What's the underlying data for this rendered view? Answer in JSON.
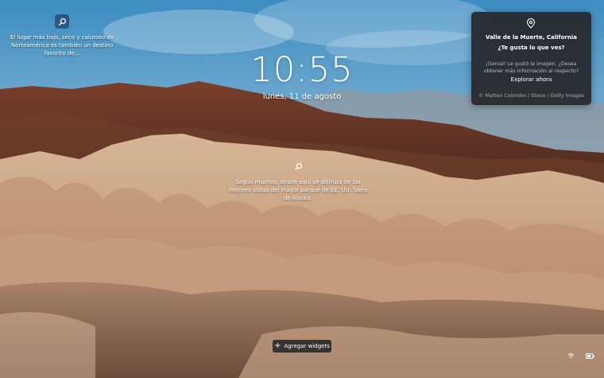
{
  "hotspots": [
    {
      "text": "El lugar más bajo, seco y caluroso de Norteamérica es también un destino favorito de..."
    },
    {
      "text": "Según muchos, desde aquí se disfruta de las mejores vistas del mayor parque de EE. UU. fuera de Alaska."
    }
  ],
  "clock": {
    "time": "10:55",
    "date": "lunes, 11 de agosto"
  },
  "card": {
    "location": "Valle de la Muerte, California",
    "question": "¿Te gusta lo que ves?",
    "feedback": "¡Genial! Le gustó la imagen. ¿Desea obtener más información al respecto?",
    "explore": "Explorar ahora",
    "credit": "© Matteo Colombo / Stone / Getty Images"
  },
  "widgets": {
    "label": "Agregar widgets",
    "icon": "plus-icon"
  },
  "tray": {
    "icons": [
      "wifi-icon",
      "battery-icon"
    ]
  },
  "icons": {
    "search": "search-icon",
    "location": "location-pin-icon"
  }
}
